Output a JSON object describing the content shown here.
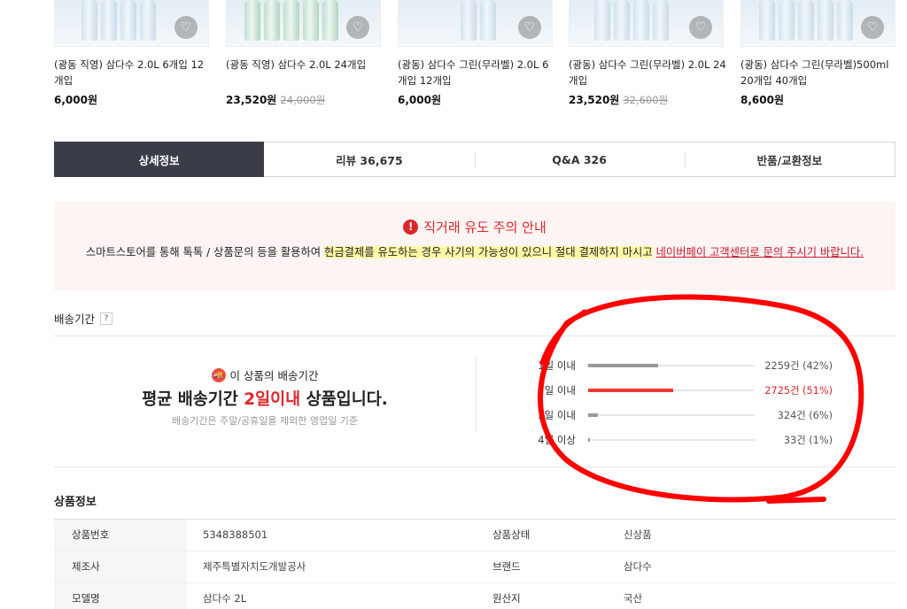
{
  "products": [
    {
      "name": "(광동 직영) 삼다수 2.0L 6개입 12개입",
      "price": "6,000원",
      "original": ""
    },
    {
      "name": "(광동 직영) 삼다수 2.0L 24개입",
      "price": "23,520원",
      "original": "24,000원"
    },
    {
      "name": "(광동) 삼다수 그린(무라벨) 2.0L 6개입 12개입",
      "price": "6,000원",
      "original": ""
    },
    {
      "name": "(광동) 삼다수 그린(무라벨) 2.0L 24개입",
      "price": "23,520원",
      "original": "32,600원"
    },
    {
      "name": "(광동) 삼다수 그린(무라벨)500ml 20개입 40개입",
      "price": "8,600원",
      "original": ""
    }
  ],
  "tabs": [
    "상세정보",
    "리뷰 36,675",
    "Q&A 326",
    "반품/교환정보"
  ],
  "warning": {
    "title": "직거래 유도 주의 안내",
    "body_plain": "스마트스토어를 통해 톡톡 / 상품문의 등을 활용하여 ",
    "body_highlight": "현금결제를 유도하는 경우 사기의 가능성이 있으니 절대 결제하지 마시고",
    "body_link": "네이버페이 고객센터로 문의 주시기 바랍니다."
  },
  "delivery": {
    "label": "배송기간",
    "help": "?",
    "sub": "이 상품의 배송기간",
    "main_pre": "평균 배송기간 ",
    "main_hl": "2일이내",
    "main_post": " 상품입니다.",
    "note": "배송기간은 주말/공휴일을 제외한 영업일 기준",
    "rows": [
      {
        "label": "1일 이내",
        "count": "2259건 (42%)",
        "pct": 42
      },
      {
        "label": "2일 이내",
        "count": "2725건 (51%)",
        "pct": 51
      },
      {
        "label": "3일 이내",
        "count": "324건 (6%)",
        "pct": 6
      },
      {
        "label": "4일 이상",
        "count": "33건 (1%)",
        "pct": 1
      }
    ]
  },
  "product_info": {
    "title": "상품정보",
    "rows": [
      [
        "상품번호",
        "5348388501",
        "상품상태",
        "신상품"
      ],
      [
        "제조사",
        "제주특별자치도개발공사",
        "브랜드",
        "삼다수"
      ],
      [
        "모델명",
        "삼다수 2L",
        "원산지",
        "국산"
      ]
    ]
  },
  "colors": {
    "accent_red": "#e0262a",
    "tab_active": "#3a3c48",
    "annotation": "#ff0000"
  },
  "icons": [
    "heart-icon",
    "exclamation-icon",
    "truck-icon"
  ]
}
